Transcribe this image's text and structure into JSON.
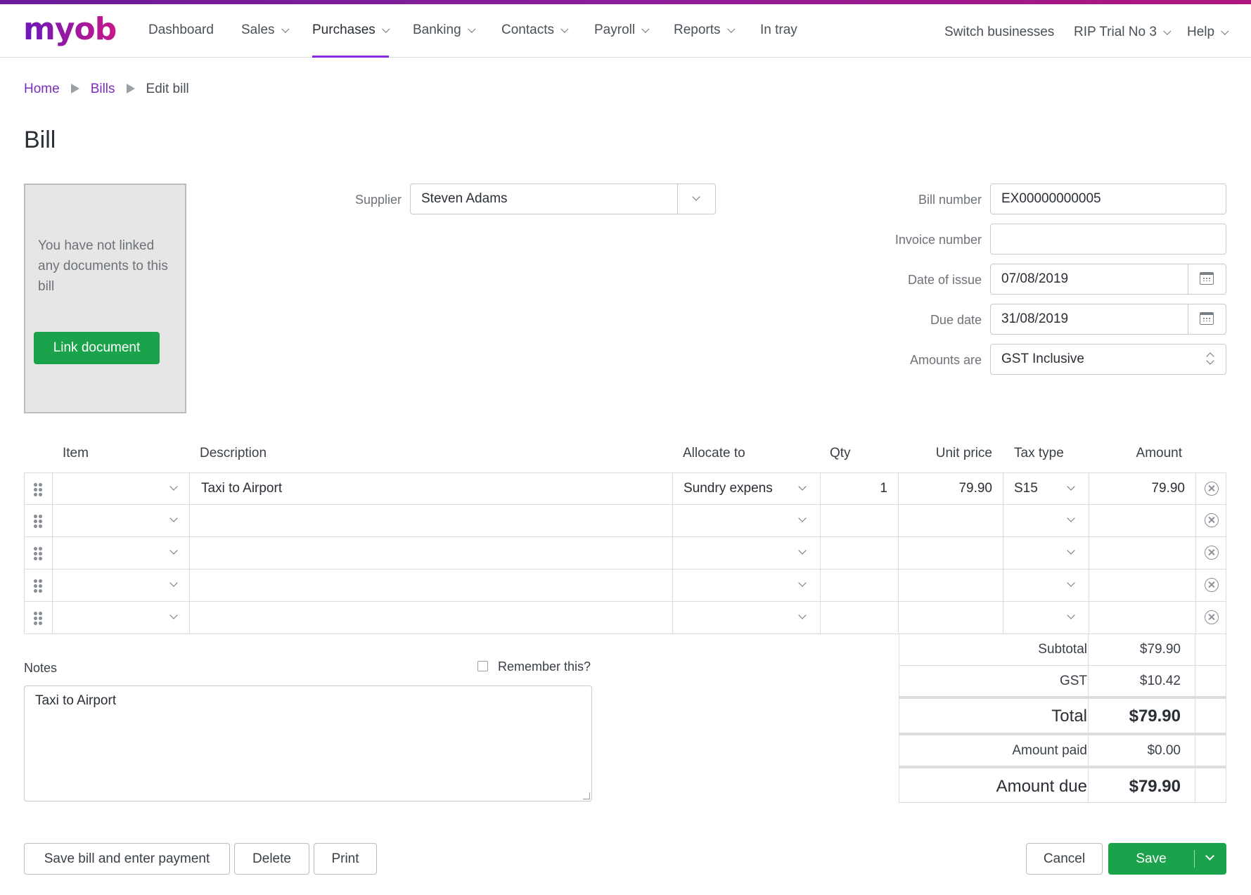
{
  "brand": {
    "logo_text": "myob",
    "accent": "#8a2be2",
    "primary_green": "#1aa34a"
  },
  "nav": {
    "items": [
      {
        "label": "Dashboard",
        "dropdown": false
      },
      {
        "label": "Sales",
        "dropdown": true
      },
      {
        "label": "Purchases",
        "dropdown": true,
        "active": true
      },
      {
        "label": "Banking",
        "dropdown": true
      },
      {
        "label": "Contacts",
        "dropdown": true
      },
      {
        "label": "Payroll",
        "dropdown": true
      },
      {
        "label": "Reports",
        "dropdown": true
      },
      {
        "label": "In tray",
        "dropdown": false
      }
    ],
    "right": {
      "switch": "Switch businesses",
      "business": "RIP Trial No 3",
      "help": "Help"
    }
  },
  "breadcrumb": {
    "home": "Home",
    "bills": "Bills",
    "current": "Edit bill"
  },
  "page_title": "Bill",
  "doc_panel": {
    "message": "You have not linked any documents to this bill",
    "button": "Link document"
  },
  "form": {
    "supplier_label": "Supplier",
    "supplier_value": "Steven Adams",
    "bill_number_label": "Bill number",
    "bill_number_value": "EX00000000005",
    "invoice_number_label": "Invoice number",
    "invoice_number_value": "",
    "date_of_issue_label": "Date of issue",
    "date_of_issue_value": "07/08/2019",
    "due_date_label": "Due date",
    "due_date_value": "31/08/2019",
    "amounts_are_label": "Amounts are",
    "amounts_are_value": "GST Inclusive"
  },
  "table": {
    "headers": {
      "item": "Item",
      "description": "Description",
      "allocate_to": "Allocate to",
      "qty": "Qty",
      "unit_price": "Unit price",
      "tax_type": "Tax type",
      "amount": "Amount"
    },
    "rows": [
      {
        "item": "",
        "description": "Taxi to Airport",
        "allocate_to": "Sundry expens",
        "qty": "1",
        "unit_price": "79.90",
        "tax_type": "S15",
        "amount": "79.90"
      },
      {
        "item": "",
        "description": "",
        "allocate_to": "",
        "qty": "",
        "unit_price": "",
        "tax_type": "",
        "amount": ""
      },
      {
        "item": "",
        "description": "",
        "allocate_to": "",
        "qty": "",
        "unit_price": "",
        "tax_type": "",
        "amount": ""
      },
      {
        "item": "",
        "description": "",
        "allocate_to": "",
        "qty": "",
        "unit_price": "",
        "tax_type": "",
        "amount": ""
      },
      {
        "item": "",
        "description": "",
        "allocate_to": "",
        "qty": "",
        "unit_price": "",
        "tax_type": "",
        "amount": ""
      }
    ]
  },
  "totals": {
    "subtotal_label": "Subtotal",
    "subtotal_value": "$79.90",
    "gst_label": "GST",
    "gst_value": "$10.42",
    "total_label": "Total",
    "total_value": "$79.90",
    "amount_paid_label": "Amount paid",
    "amount_paid_value": "$0.00",
    "amount_due_label": "Amount due",
    "amount_due_value": "$79.90"
  },
  "notes": {
    "label": "Notes",
    "remember_label": "Remember this?",
    "value": "Taxi to Airport"
  },
  "footer": {
    "save_and_pay": "Save bill and enter payment",
    "delete": "Delete",
    "print": "Print",
    "cancel": "Cancel",
    "save": "Save"
  }
}
